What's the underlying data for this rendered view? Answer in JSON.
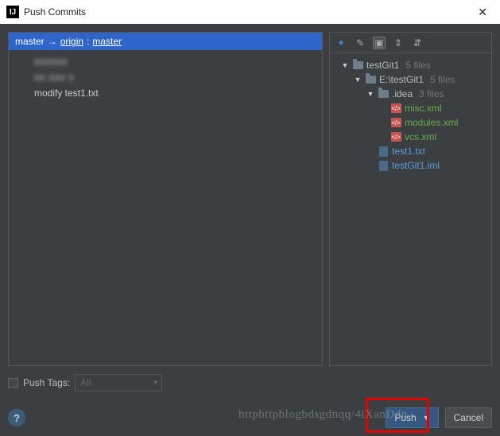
{
  "title": "Push Commits",
  "branch": {
    "local": "master",
    "remote": "origin",
    "remoteBranch": "master"
  },
  "commits": [
    {
      "msg": "xxxxxx",
      "blur": true
    },
    {
      "msg": "xx xxx x",
      "blur": true
    },
    {
      "msg": "modify test1.txt",
      "blur": false
    }
  ],
  "tree": {
    "root": {
      "name": "testGit1",
      "hint": "5 files"
    },
    "sub1": {
      "name": "E:\\testGit1",
      "hint": "5 files"
    },
    "idea": {
      "name": ".idea",
      "hint": "3 files"
    },
    "files": {
      "misc": "misc.xml",
      "modules": "modules.xml",
      "vcs": "vcs.xml",
      "test1": "test1.txt",
      "iml": "testGit1.iml"
    }
  },
  "pushTags": {
    "label": "Push Tags:",
    "value": "All"
  },
  "buttons": {
    "push": "Push",
    "cancel": "Cancel"
  },
  "watermark": "httpbttpblogbdsgdnqq/4iXanDdn"
}
